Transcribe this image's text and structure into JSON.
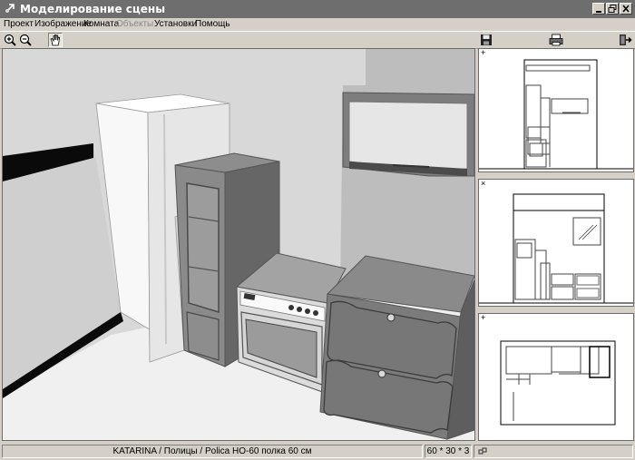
{
  "window": {
    "title": "Моделирование сцены",
    "controls": [
      "minimize",
      "maximize",
      "close"
    ]
  },
  "menu": {
    "items": [
      {
        "label": "Проект",
        "enabled": true
      },
      {
        "label": "Изображение",
        "enabled": true
      },
      {
        "label": "Комната",
        "enabled": true
      },
      {
        "label": "Объекты",
        "enabled": false
      },
      {
        "label": "Установки",
        "enabled": true
      },
      {
        "label": "Помощь",
        "enabled": true
      }
    ]
  },
  "toolbar": {
    "left_icons": [
      "zoom-in-icon",
      "zoom-out-icon",
      "pan-hand-icon"
    ],
    "right_icons": [
      "save-icon",
      "print-icon",
      "exit-icon"
    ]
  },
  "views": {
    "main": "3d-perspective",
    "side_markers": [
      "+",
      "×",
      "+"
    ]
  },
  "status": {
    "object_path": "KATARINA / Полицы / Polica HO-60 полка 60 см",
    "dimensions": "60 * 30 * 3"
  }
}
